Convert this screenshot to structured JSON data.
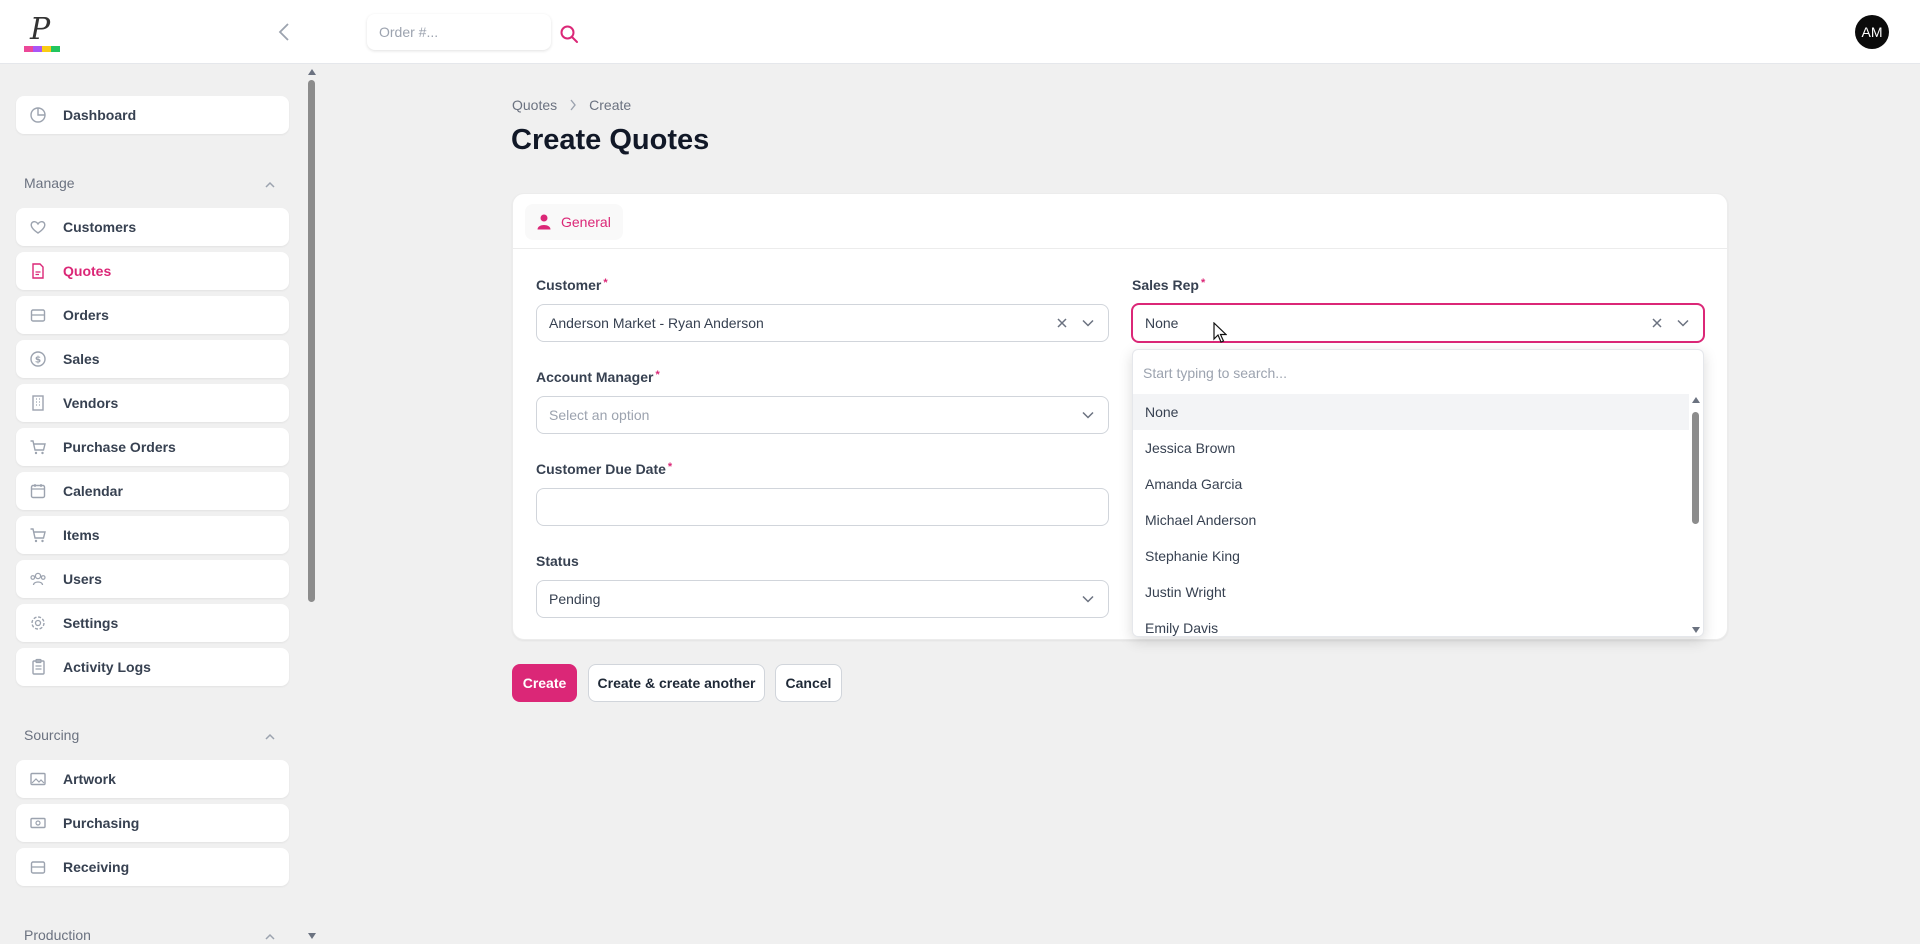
{
  "topbar": {
    "search_placeholder": "Order #...",
    "avatar_initials": "AM"
  },
  "brand": {
    "logo_letter": "P",
    "logo_colors": [
      "#ec4899",
      "#a855f7",
      "#facc15",
      "#22c55e"
    ]
  },
  "sidebar": {
    "dashboard": "Dashboard",
    "sections": [
      {
        "label": "Manage"
      },
      {
        "label": "Sourcing"
      },
      {
        "label": "Production"
      }
    ],
    "manage_items": [
      {
        "label": "Customers",
        "icon": "heart-icon"
      },
      {
        "label": "Quotes",
        "icon": "document-icon"
      },
      {
        "label": "Orders",
        "icon": "tray-icon"
      },
      {
        "label": "Sales",
        "icon": "dollar-circle-icon"
      },
      {
        "label": "Vendors",
        "icon": "building-icon"
      },
      {
        "label": "Purchase Orders",
        "icon": "cart-icon"
      },
      {
        "label": "Calendar",
        "icon": "calendar-icon"
      },
      {
        "label": "Items",
        "icon": "cart-icon"
      },
      {
        "label": "Users",
        "icon": "users-icon"
      },
      {
        "label": "Settings",
        "icon": "gear-icon"
      },
      {
        "label": "Activity Logs",
        "icon": "clipboard-icon"
      }
    ],
    "sourcing_items": [
      {
        "label": "Artwork",
        "icon": "image-icon"
      },
      {
        "label": "Purchasing",
        "icon": "cash-icon"
      },
      {
        "label": "Receiving",
        "icon": "tray-icon"
      }
    ],
    "active": "Quotes"
  },
  "breadcrumb": {
    "parent": "Quotes",
    "current": "Create"
  },
  "page_title": "Create Quotes",
  "tabs": {
    "general": "General"
  },
  "form": {
    "customer": {
      "label": "Customer",
      "value": "Anderson Market - Ryan Anderson"
    },
    "sales_rep": {
      "label": "Sales Rep",
      "value": "None"
    },
    "account_manager": {
      "label": "Account Manager",
      "placeholder": "Select an option"
    },
    "customer_due_date": {
      "label": "Customer Due Date",
      "value": ""
    },
    "status": {
      "label": "Status",
      "value": "Pending"
    },
    "required_mark": "*"
  },
  "dropdown": {
    "search_placeholder": "Start typing to search...",
    "options": [
      "None",
      "Jessica Brown",
      "Amanda Garcia",
      "Michael Anderson",
      "Stephanie King",
      "Justin Wright",
      "Emily Davis"
    ],
    "selected": "None"
  },
  "actions": {
    "create": "Create",
    "create_another": "Create & create another",
    "cancel": "Cancel"
  },
  "colors": {
    "accent": "#db2777"
  }
}
